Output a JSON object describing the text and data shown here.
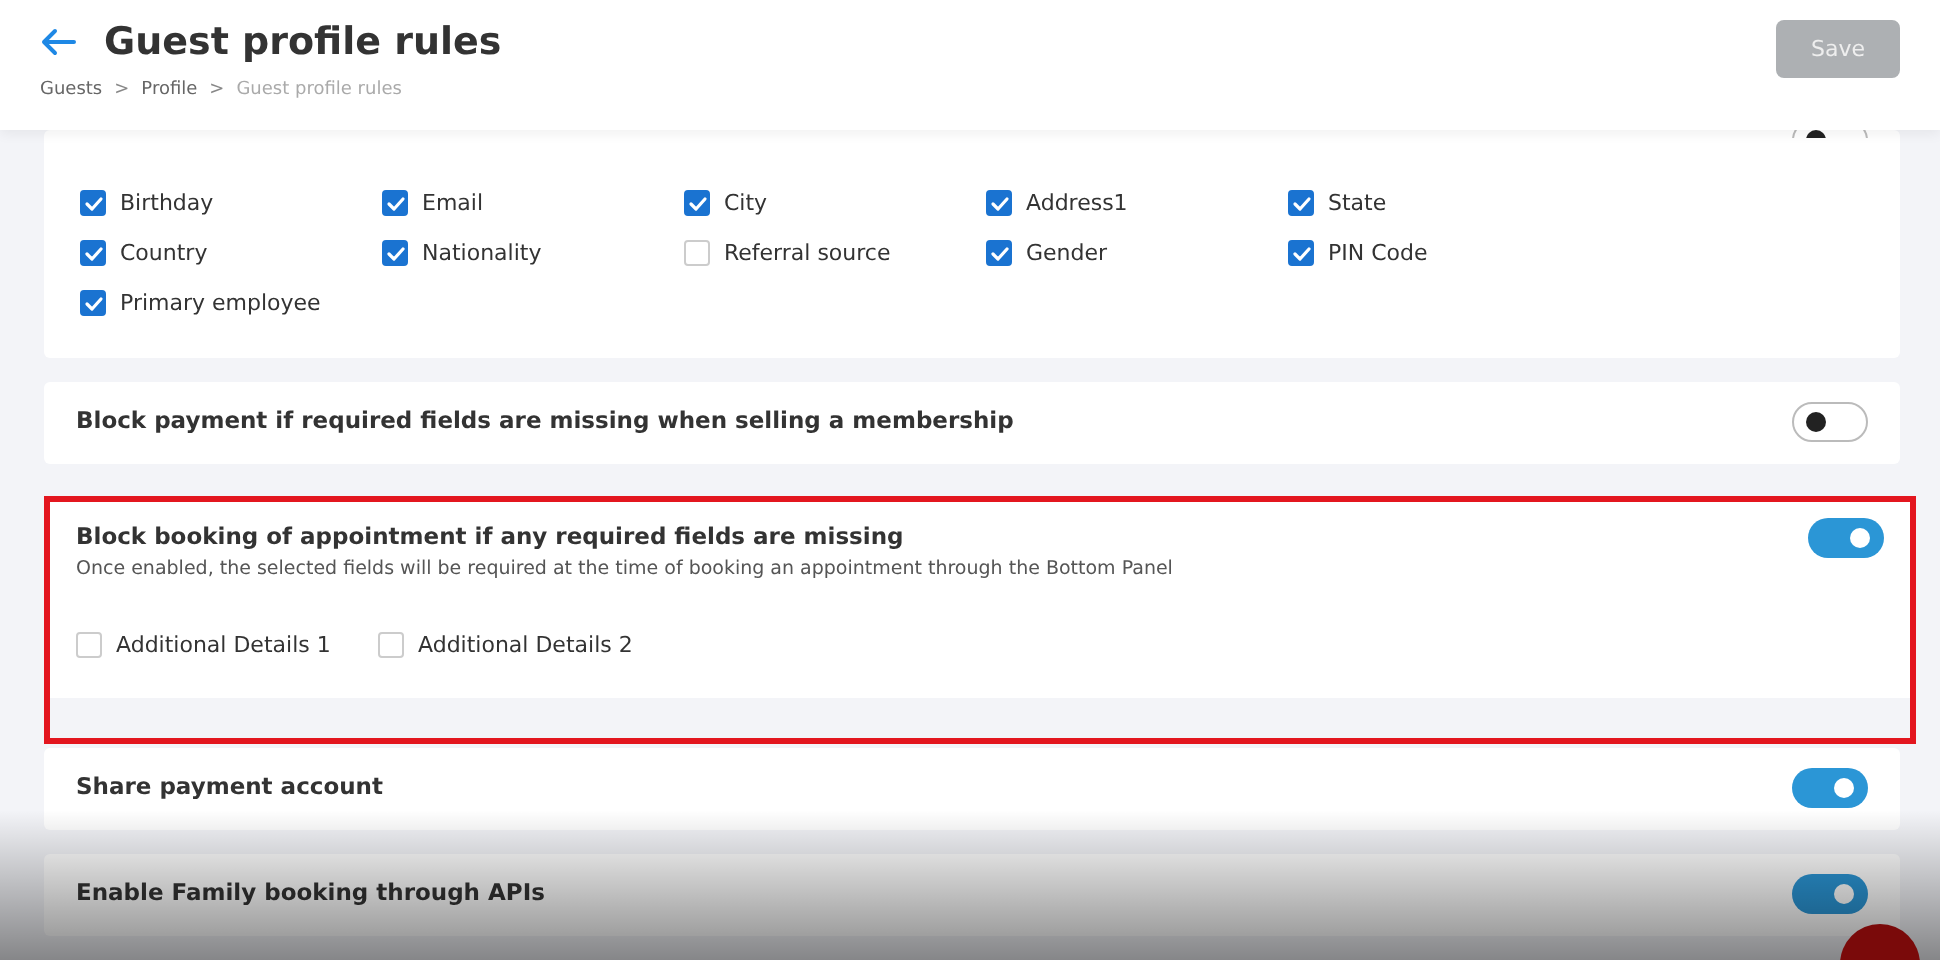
{
  "header": {
    "title": "Guest profile rules",
    "breadcrumbs": [
      {
        "label": "Guests",
        "current": false
      },
      {
        "label": "Profile",
        "current": false
      },
      {
        "label": "Guest profile rules",
        "current": true
      }
    ],
    "separator": ">",
    "save_button": {
      "label": "Save",
      "disabled": true
    }
  },
  "sections": [
    {
      "kind": "fields",
      "toggle_on": false,
      "fields": [
        {
          "label": "Birthday",
          "checked": true
        },
        {
          "label": "Email",
          "checked": true
        },
        {
          "label": "City",
          "checked": true
        },
        {
          "label": "Address1",
          "checked": true
        },
        {
          "label": "State",
          "checked": true
        },
        {
          "label": "Country",
          "checked": true
        },
        {
          "label": "Nationality",
          "checked": true
        },
        {
          "label": "Referral source",
          "checked": false
        },
        {
          "label": "Gender",
          "checked": true
        },
        {
          "label": "PIN Code",
          "checked": true
        },
        {
          "label": "Primary employee",
          "checked": true
        }
      ]
    },
    {
      "kind": "setting",
      "title": "Block payment if required fields are missing when selling a membership",
      "on": false,
      "highlighted": false
    },
    {
      "kind": "setting",
      "title": "Block booking of appointment if any required fields are missing",
      "description": "Once enabled, the selected fields will be required at the time of booking an appointment through the Bottom Panel",
      "on": true,
      "highlighted": true,
      "fields": [
        {
          "label": "Additional Details 1",
          "checked": false
        },
        {
          "label": "Additional Details 2",
          "checked": false
        }
      ]
    },
    {
      "kind": "setting",
      "title": "Share payment account",
      "on": true,
      "highlighted": false
    },
    {
      "kind": "setting",
      "title": "Enable Family booking through APIs",
      "on": true,
      "highlighted": false
    }
  ]
}
